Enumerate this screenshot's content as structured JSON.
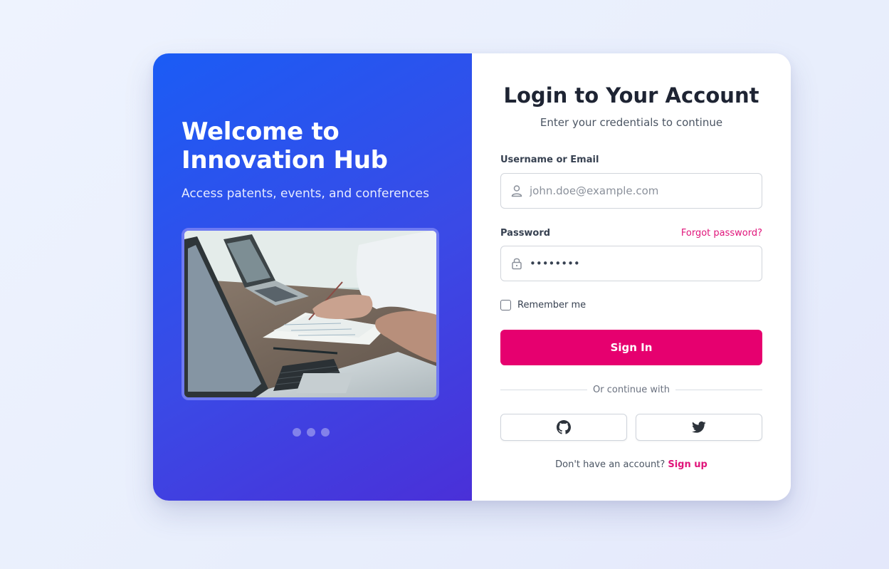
{
  "colors": {
    "accent": "#e6006f",
    "panel_gradient_start": "#1b5cf5",
    "panel_gradient_end": "#4a30d8"
  },
  "hero": {
    "title": "Welcome to Innovation Hub",
    "tagline": "Access patents, events, and conferences",
    "image_icon": "laptops-meeting-photo",
    "carousel_dots": 3
  },
  "login": {
    "title": "Login to Your Account",
    "subtitle": "Enter your credentials to continue",
    "username_label": "Username or Email",
    "username_placeholder": "john.doe@example.com",
    "username_icon": "user-icon",
    "password_label": "Password",
    "password_value": "password",
    "password_icon": "lock-icon",
    "forgot_label": "Forgot password?",
    "remember_label": "Remember me",
    "remember_checked": false,
    "signin_label": "Sign In",
    "divider_text": "Or continue with",
    "social": [
      {
        "icon": "github-icon"
      },
      {
        "icon": "twitter-icon"
      }
    ],
    "signup_prompt": "Don't have an account?",
    "signup_label": "Sign up"
  }
}
